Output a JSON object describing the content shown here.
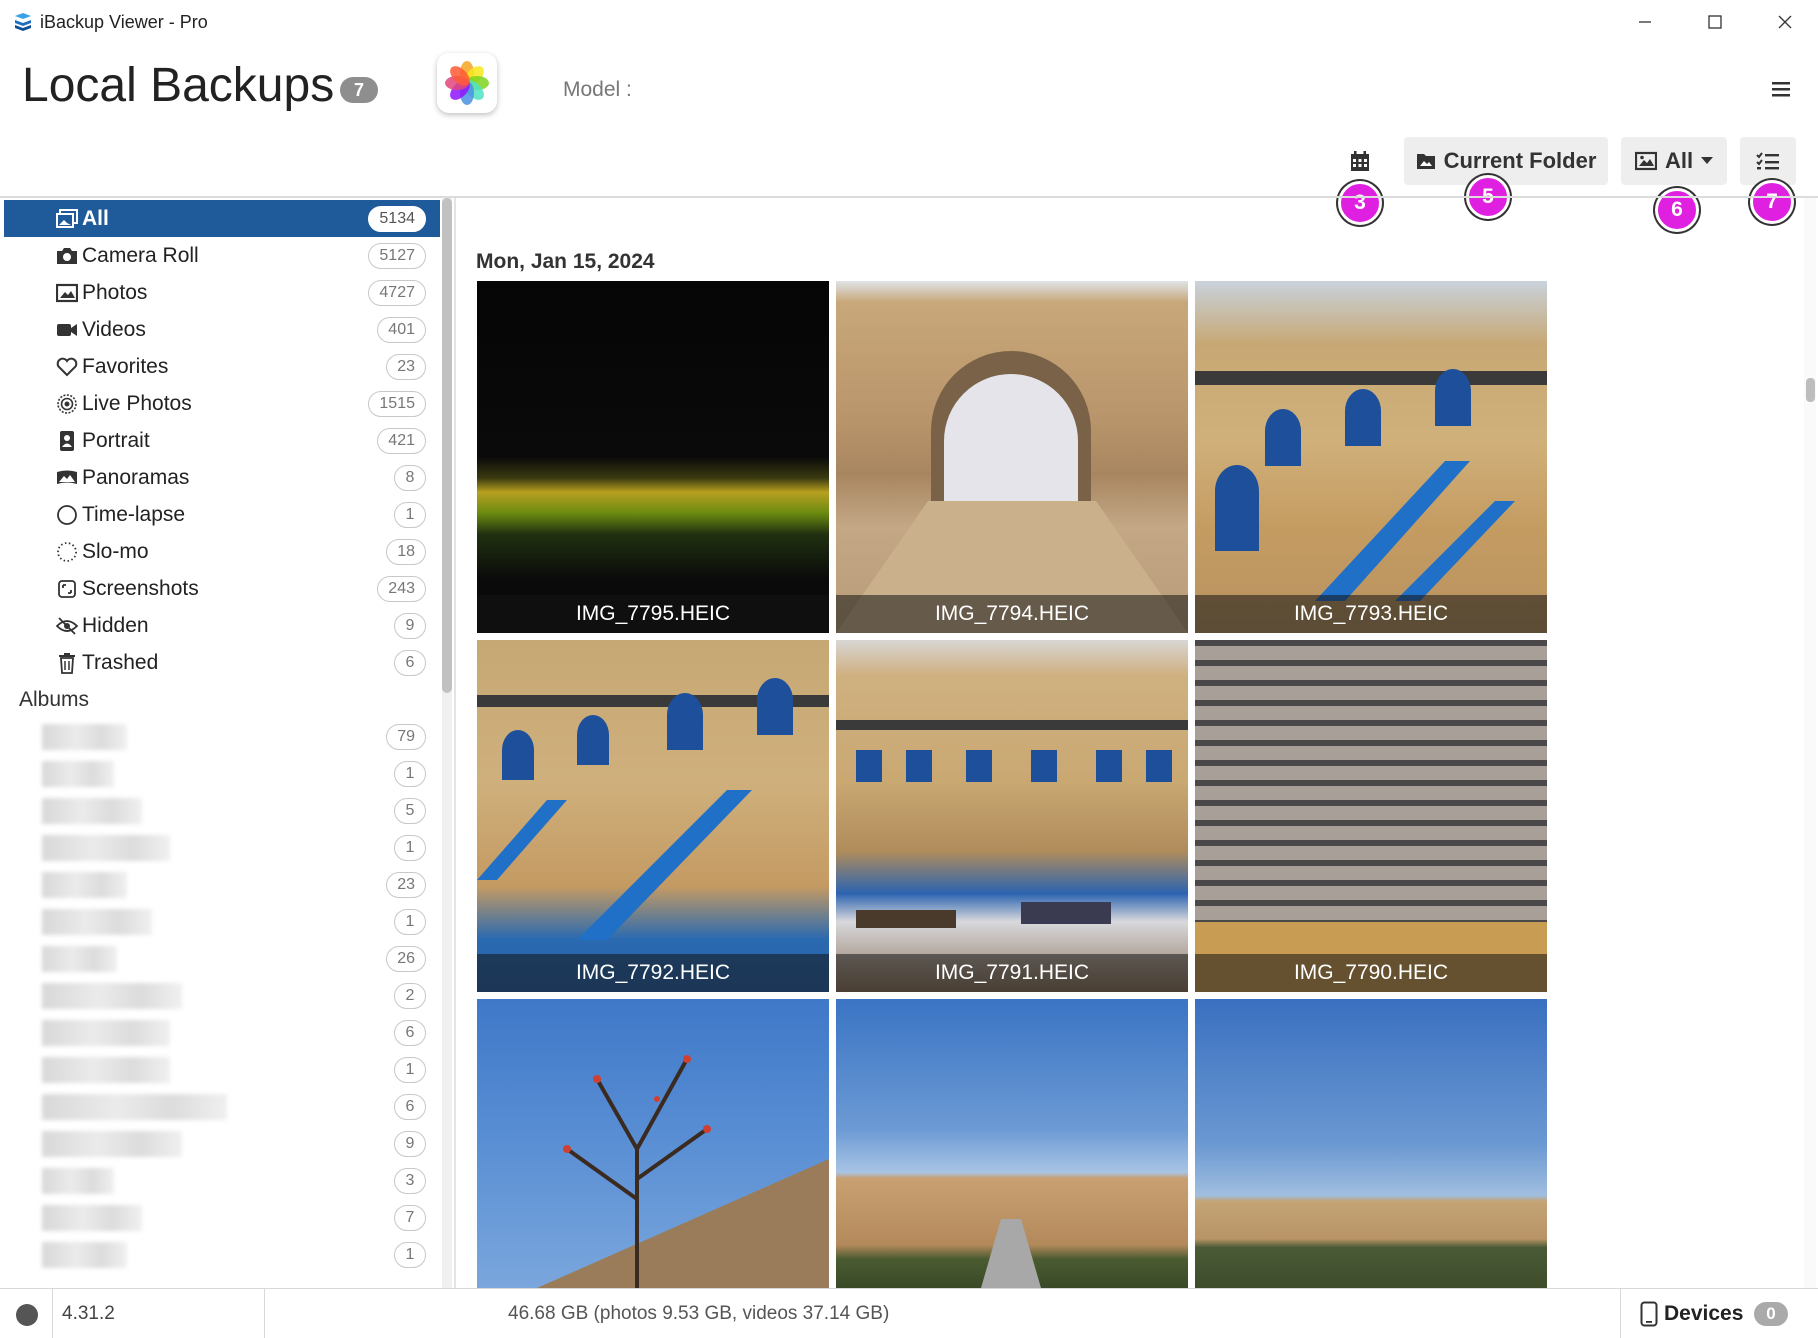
{
  "window": {
    "title": "iBackup Viewer - Pro"
  },
  "header": {
    "title": "Local Backups",
    "badge": "7",
    "model_label": "Model :"
  },
  "toolbar": {
    "current_folder_label": "Current Folder",
    "filter_label": "All",
    "markers": {
      "calendar": "3",
      "folder": "5",
      "filter": "6",
      "view": "7"
    }
  },
  "sidebar": {
    "items": [
      {
        "label": "All",
        "count": "5134",
        "icon": "all-photos-icon"
      },
      {
        "label": "Camera Roll",
        "count": "5127",
        "icon": "camera-icon"
      },
      {
        "label": "Photos",
        "count": "4727",
        "icon": "image-icon"
      },
      {
        "label": "Videos",
        "count": "401",
        "icon": "video-camera-icon"
      },
      {
        "label": "Favorites",
        "count": "23",
        "icon": "heart-icon"
      },
      {
        "label": "Live Photos",
        "count": "1515",
        "icon": "live-photo-icon"
      },
      {
        "label": "Portrait",
        "count": "421",
        "icon": "portrait-icon"
      },
      {
        "label": "Panoramas",
        "count": "8",
        "icon": "panorama-icon"
      },
      {
        "label": "Time-lapse",
        "count": "1",
        "icon": "timelapse-icon"
      },
      {
        "label": "Slo-mo",
        "count": "18",
        "icon": "slomo-icon"
      },
      {
        "label": "Screenshots",
        "count": "243",
        "icon": "screenshot-icon"
      },
      {
        "label": "Hidden",
        "count": "9",
        "icon": "eye-slash-icon"
      },
      {
        "label": "Trashed",
        "count": "6",
        "icon": "trash-icon"
      }
    ],
    "albums_header": "Albums",
    "album_counts": [
      "79",
      "1",
      "5",
      "1",
      "23",
      "1",
      "26",
      "2",
      "6",
      "1",
      "6",
      "9",
      "3",
      "7",
      "1"
    ]
  },
  "main": {
    "date_header": "Mon, Jan 15, 2024",
    "photos": [
      {
        "name": "IMG_7795.HEIC"
      },
      {
        "name": "IMG_7794.HEIC"
      },
      {
        "name": "IMG_7793.HEIC"
      },
      {
        "name": "IMG_7792.HEIC"
      },
      {
        "name": "IMG_7791.HEIC"
      },
      {
        "name": "IMG_7790.HEIC"
      },
      {
        "name": ""
      },
      {
        "name": ""
      },
      {
        "name": ""
      }
    ]
  },
  "status": {
    "version": "4.31.2",
    "storage": "46.68 GB (photos 9.53 GB, videos 37.14 GB)",
    "devices_label": "Devices",
    "devices_count": "0"
  },
  "colors": {
    "accent": "#1f5a9a",
    "marker": "#e020e0"
  }
}
